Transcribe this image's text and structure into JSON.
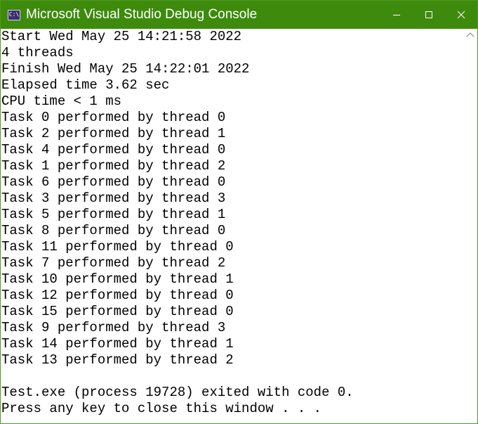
{
  "window": {
    "title": "Microsoft Visual Studio Debug Console",
    "icon": "console-app-icon",
    "icon_text": "C:\\",
    "controls": [
      "minimize-icon",
      "maximize-icon",
      "close-icon"
    ],
    "colors": {
      "titlebar": "#3d8a0d",
      "titlebar_text": "#ffffff",
      "console_background": "#ffffff",
      "console_text": "#000000"
    }
  },
  "console": {
    "lines": [
      "Start Wed May 25 14:21:58 2022",
      "4 threads",
      "Finish Wed May 25 14:22:01 2022",
      "Elapsed time 3.62 sec",
      "CPU time < 1 ms",
      "Task 0 performed by thread 0",
      "Task 2 performed by thread 1",
      "Task 4 performed by thread 0",
      "Task 1 performed by thread 2",
      "Task 6 performed by thread 0",
      "Task 3 performed by thread 3",
      "Task 5 performed by thread 1",
      "Task 8 performed by thread 0",
      "Task 11 performed by thread 0",
      "Task 7 performed by thread 2",
      "Task 10 performed by thread 1",
      "Task 12 performed by thread 0",
      "Task 15 performed by thread 0",
      "Task 9 performed by thread 3",
      "Task 14 performed by thread 1",
      "Task 13 performed by thread 2",
      "",
      "Test.exe (process 19728) exited with code 0.",
      "Press any key to close this window . . ."
    ]
  }
}
